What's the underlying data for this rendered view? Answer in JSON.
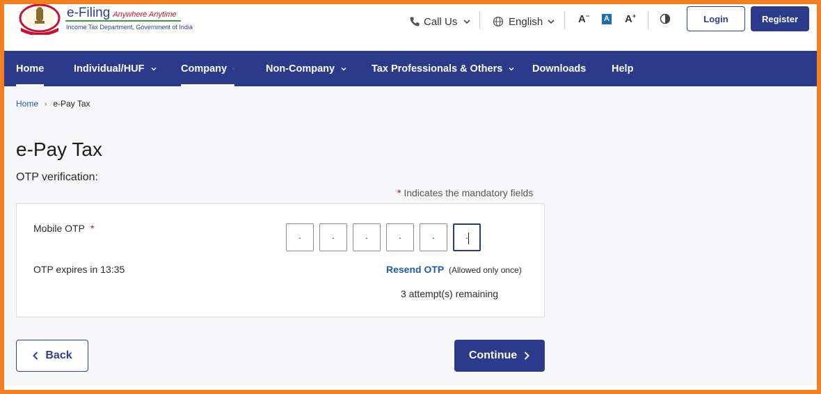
{
  "header": {
    "brand_title": "e-Filing",
    "brand_tagline": "Anywhere Anytime",
    "brand_subtitle": "Income Tax Department, Government of India",
    "call_us": "Call Us",
    "language": "English",
    "font_decrease": "A",
    "font_default": "A",
    "font_increase": "A",
    "login_label": "Login",
    "register_label": "Register"
  },
  "nav": {
    "items": [
      {
        "label": "Home",
        "has_dropdown": false,
        "active": true
      },
      {
        "label": "Individual/HUF",
        "has_dropdown": true,
        "active": false
      },
      {
        "label": "Company",
        "has_dropdown": true,
        "active": true
      },
      {
        "label": "Non-Company",
        "has_dropdown": true,
        "active": false
      },
      {
        "label": "Tax Professionals & Others",
        "has_dropdown": true,
        "active": false
      },
      {
        "label": "Downloads",
        "has_dropdown": false,
        "active": false
      },
      {
        "label": "Help",
        "has_dropdown": false,
        "active": false
      }
    ]
  },
  "breadcrumb": {
    "home": "Home",
    "current": "e-Pay Tax"
  },
  "page": {
    "title": "e-Pay Tax",
    "section": "OTP verification:",
    "mandatory_star": "*",
    "mandatory_note": "Indicates the mandatory fields"
  },
  "otp_card": {
    "label": "Mobile OTP",
    "required_star": "*",
    "digits": [
      "·",
      "·",
      "·",
      "·",
      "·",
      "·"
    ],
    "expires_text": "OTP expires in 13:35",
    "resend_label": "Resend OTP",
    "allowed_note": "(Allowed only once)",
    "attempts_text": "3 attempt(s) remaining"
  },
  "actions": {
    "back_label": "Back",
    "continue_label": "Continue"
  },
  "colors": {
    "frame_orange": "#f47f20",
    "nav_blue": "#2b3a8a",
    "link_blue": "#1a5fa6",
    "required_red": "#c8102e"
  }
}
